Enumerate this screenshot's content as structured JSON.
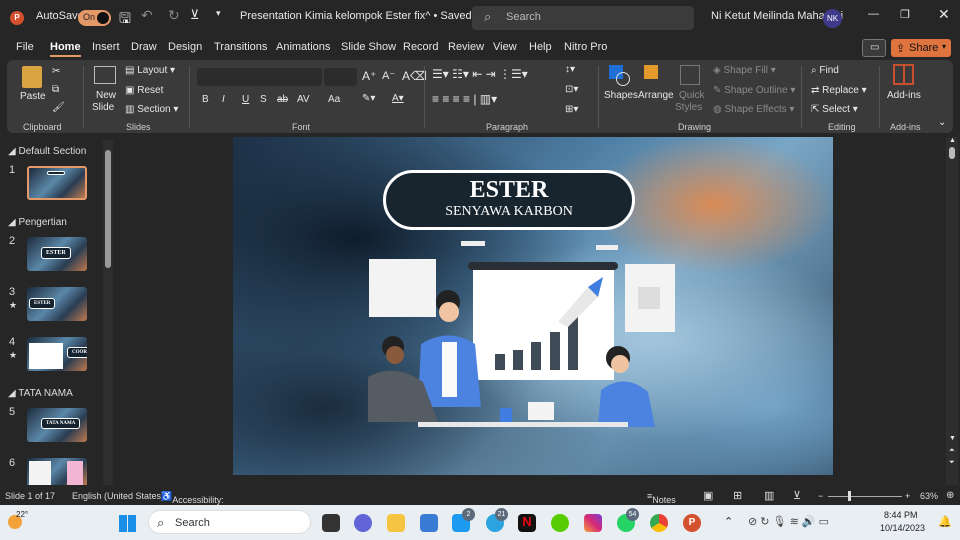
{
  "titlebar": {
    "autosave_label": "AutoSave",
    "autosave_state": "On",
    "document_title": "Presentation Kimia kelompok Ester fix^ • Saved",
    "search_placeholder": "Search",
    "user_name": "Ni Ketut Meilinda Maharani",
    "user_initials": "NK"
  },
  "menu": {
    "tabs": [
      "File",
      "Home",
      "Insert",
      "Draw",
      "Design",
      "Transitions",
      "Animations",
      "Slide Show",
      "Record",
      "Review",
      "View",
      "Help",
      "Nitro Pro"
    ],
    "active": "Home",
    "share_label": "Share"
  },
  "ribbon": {
    "clipboard": {
      "paste": "Paste",
      "group": "Clipboard"
    },
    "slides": {
      "new_slide_1": "New",
      "new_slide_2": "Slide",
      "layout": "Layout",
      "reset": "Reset",
      "section": "Section",
      "group": "Slides"
    },
    "font": {
      "group": "Font",
      "bold": "B",
      "italic": "I",
      "underline": "U",
      "shadow": "S",
      "strike": "ab",
      "spacing": "AV",
      "case": "Aa"
    },
    "paragraph": {
      "group": "Paragraph"
    },
    "drawing": {
      "shapes": "Shapes",
      "arrange": "Arrange",
      "quick_styles_1": "Quick",
      "quick_styles_2": "Styles",
      "shape_fill": "Shape Fill",
      "shape_outline": "Shape Outline",
      "shape_effects": "Shape Effects",
      "group": "Drawing"
    },
    "editing": {
      "find": "Find",
      "replace": "Replace",
      "select": "Select",
      "group": "Editing"
    },
    "addins": {
      "label": "Add-ins",
      "group": "Add-ins"
    }
  },
  "slide_panel": {
    "sections": [
      "Default Section",
      "Pengertian",
      "TATA NAMA"
    ],
    "thumbnails": [
      {
        "number": "1",
        "label": ""
      },
      {
        "number": "2",
        "label": "ESTER"
      },
      {
        "number": "3",
        "label": "ESTER"
      },
      {
        "number": "4",
        "label": "COOR"
      },
      {
        "number": "5",
        "label": "TATA NAMA"
      },
      {
        "number": "6",
        "label": ""
      }
    ]
  },
  "slide": {
    "title": "ESTER",
    "subtitle": "SENYAWA KARBON"
  },
  "status": {
    "slide_count": "Slide 1 of 17",
    "language": "English (United States)",
    "accessibility": "Accessibility: Investigate",
    "notes": "Notes",
    "zoom": "63%",
    "zoom_percent": 63
  },
  "taskbar": {
    "weather": "22°",
    "search": "Search",
    "badges": {
      "twitter": "2",
      "telegram": "21",
      "whatsapp": "54"
    },
    "time": "8:44 PM",
    "date": "10/14/2023"
  },
  "colors": {
    "accent": "#e59868",
    "share": "#e0743f",
    "ribbon_bg": "#3a3a3a",
    "slide_title_bg": "#18252f"
  }
}
